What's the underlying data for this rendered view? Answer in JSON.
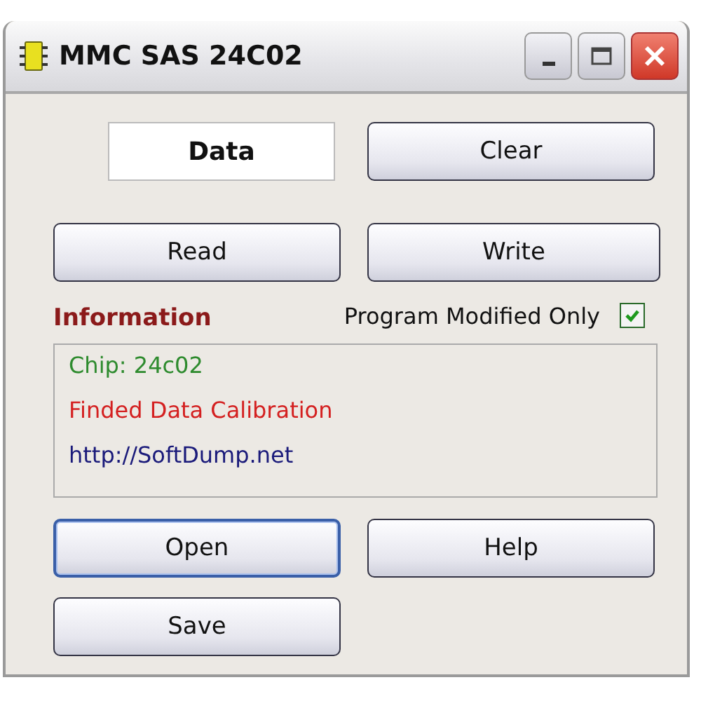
{
  "window": {
    "title": "MMC SAS 24C02"
  },
  "data_label": "Data",
  "buttons_top": [
    {
      "label": "Clear",
      "focused": false
    }
  ],
  "buttons_rw": [
    {
      "label": "Read",
      "focused": false
    },
    {
      "label": "Write",
      "focused": false
    }
  ],
  "information": {
    "heading": "Information",
    "checkbox": {
      "label": "Program Modified Only",
      "checked": true
    }
  },
  "log": [
    {
      "text": "Chip: 24c02",
      "color": "#2e8b2e"
    },
    {
      "text": "Finded Data Calibration",
      "color": "#d42020"
    },
    {
      "text": "http://SoftDump.net",
      "color": "#1a1a7a"
    }
  ],
  "buttons_bottom": [
    {
      "label": "Open",
      "focused": true
    },
    {
      "label": "Help",
      "focused": false
    },
    {
      "label": "Save",
      "focused": false
    }
  ]
}
